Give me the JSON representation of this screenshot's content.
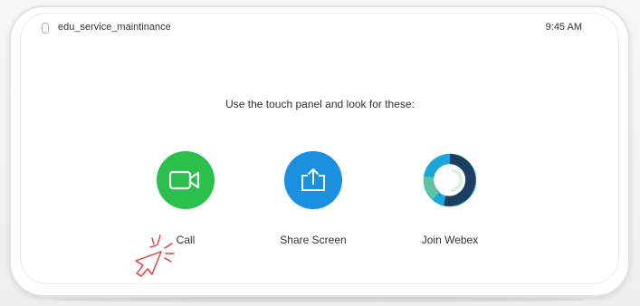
{
  "header": {
    "device_name": "edu_service_maintinance",
    "time": "9:45 AM"
  },
  "instruction": "Use the touch panel and look for these:",
  "actions": [
    {
      "label": "Call",
      "icon": "video-camera-icon",
      "color": "#2bbf4c"
    },
    {
      "label": "Share Screen",
      "icon": "share-screen-icon",
      "color": "#1b8fe0"
    },
    {
      "label": "Join Webex",
      "icon": "webex-logo-icon",
      "color": "#1ba6d9"
    }
  ],
  "annotation": {
    "icon": "tap-pointer-icon",
    "color": "#e03a3a"
  }
}
